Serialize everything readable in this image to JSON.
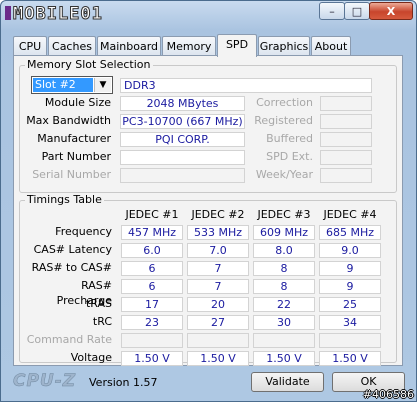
{
  "app": {
    "logo_text": "MOBILE01",
    "brand": "CPU-Z",
    "version": "Version 1.57"
  },
  "window_controls": {
    "minimize": "–",
    "maximize": "□",
    "close": "X"
  },
  "tabs": [
    {
      "label": "CPU"
    },
    {
      "label": "Caches"
    },
    {
      "label": "Mainboard"
    },
    {
      "label": "Memory"
    },
    {
      "label": "SPD"
    },
    {
      "label": "Graphics"
    },
    {
      "label": "About"
    }
  ],
  "slot": {
    "group_title": "Memory Slot Selection",
    "selected": "Slot #2",
    "type": "DDR3",
    "fields": {
      "module_size": {
        "label": "Module Size",
        "value": "2048 MBytes"
      },
      "max_bandwidth": {
        "label": "Max Bandwidth",
        "value": "PC3-10700 (667 MHz)"
      },
      "manufacturer": {
        "label": "Manufacturer",
        "value": "PQI CORP."
      },
      "part_number": {
        "label": "Part Number",
        "value": ""
      },
      "serial_number": {
        "label": "Serial Number",
        "value": ""
      },
      "correction": {
        "label": "Correction",
        "value": ""
      },
      "registered": {
        "label": "Registered",
        "value": ""
      },
      "buffered": {
        "label": "Buffered",
        "value": ""
      },
      "spd_ext": {
        "label": "SPD Ext.",
        "value": ""
      },
      "week_year": {
        "label": "Week/Year",
        "value": ""
      }
    }
  },
  "timings": {
    "group_title": "Timings Table",
    "columns": [
      "JEDEC #1",
      "JEDEC #2",
      "JEDEC #3",
      "JEDEC #4"
    ],
    "rows": [
      {
        "label": "Frequency",
        "values": [
          "457 MHz",
          "533 MHz",
          "609 MHz",
          "685 MHz"
        ]
      },
      {
        "label": "CAS# Latency",
        "values": [
          "6.0",
          "7.0",
          "8.0",
          "9.0"
        ]
      },
      {
        "label": "RAS# to CAS#",
        "values": [
          "6",
          "7",
          "8",
          "9"
        ]
      },
      {
        "label": "RAS# Precharge",
        "values": [
          "6",
          "7",
          "8",
          "9"
        ]
      },
      {
        "label": "tRAS",
        "values": [
          "17",
          "20",
          "22",
          "25"
        ]
      },
      {
        "label": "tRC",
        "values": [
          "23",
          "27",
          "30",
          "34"
        ]
      },
      {
        "label": "Command Rate",
        "values": [
          "",
          "",
          "",
          ""
        ]
      },
      {
        "label": "Voltage",
        "values": [
          "1.50 V",
          "1.50 V",
          "1.50 V",
          "1.50 V"
        ]
      }
    ]
  },
  "buttons": {
    "validate": "Validate",
    "ok": "OK"
  },
  "watermark": "#406586"
}
